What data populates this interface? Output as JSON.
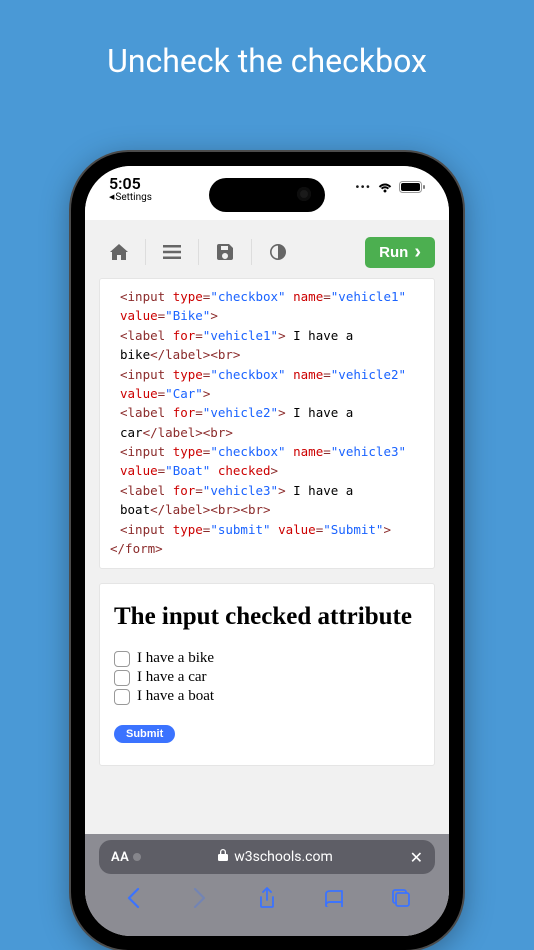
{
  "banner": "Uncheck the checkbox",
  "status": {
    "time": "5:05",
    "back_label": "Settings"
  },
  "toolbar": {
    "run_label": "Run"
  },
  "code": {
    "lines": [
      {
        "indent": 1,
        "parts": [
          {
            "c": "tag",
            "t": "<input"
          },
          {
            "c": "txt",
            "t": " "
          },
          {
            "c": "attr",
            "t": "type"
          },
          {
            "c": "tag",
            "t": "="
          },
          {
            "c": "val",
            "t": "\"checkbox\""
          },
          {
            "c": "txt",
            "t": " "
          },
          {
            "c": "attr",
            "t": "name"
          },
          {
            "c": "tag",
            "t": "="
          },
          {
            "c": "val",
            "t": "\"vehicle1\""
          },
          {
            "c": "txt",
            "t": " "
          },
          {
            "c": "attr",
            "t": "value"
          },
          {
            "c": "tag",
            "t": "="
          },
          {
            "c": "val",
            "t": "\"Bike\""
          },
          {
            "c": "tag",
            "t": ">"
          }
        ]
      },
      {
        "indent": 1,
        "parts": [
          {
            "c": "tag",
            "t": "<label"
          },
          {
            "c": "txt",
            "t": " "
          },
          {
            "c": "attr",
            "t": "for"
          },
          {
            "c": "tag",
            "t": "="
          },
          {
            "c": "val",
            "t": "\"vehicle1\""
          },
          {
            "c": "tag",
            "t": ">"
          },
          {
            "c": "txt",
            "t": " I have a bike"
          },
          {
            "c": "tag",
            "t": "</label><br>"
          }
        ]
      },
      {
        "indent": 1,
        "parts": [
          {
            "c": "tag",
            "t": "<input"
          },
          {
            "c": "txt",
            "t": " "
          },
          {
            "c": "attr",
            "t": "type"
          },
          {
            "c": "tag",
            "t": "="
          },
          {
            "c": "val",
            "t": "\"checkbox\""
          },
          {
            "c": "txt",
            "t": " "
          },
          {
            "c": "attr",
            "t": "name"
          },
          {
            "c": "tag",
            "t": "="
          },
          {
            "c": "val",
            "t": "\"vehicle2\""
          },
          {
            "c": "txt",
            "t": " "
          },
          {
            "c": "attr",
            "t": "value"
          },
          {
            "c": "tag",
            "t": "="
          },
          {
            "c": "val",
            "t": "\"Car\""
          },
          {
            "c": "tag",
            "t": ">"
          }
        ]
      },
      {
        "indent": 1,
        "parts": [
          {
            "c": "tag",
            "t": "<label"
          },
          {
            "c": "txt",
            "t": " "
          },
          {
            "c": "attr",
            "t": "for"
          },
          {
            "c": "tag",
            "t": "="
          },
          {
            "c": "val",
            "t": "\"vehicle2\""
          },
          {
            "c": "tag",
            "t": ">"
          },
          {
            "c": "txt",
            "t": " I have a car"
          },
          {
            "c": "tag",
            "t": "</label><br>"
          }
        ]
      },
      {
        "indent": 1,
        "parts": [
          {
            "c": "tag",
            "t": "<input"
          },
          {
            "c": "txt",
            "t": " "
          },
          {
            "c": "attr",
            "t": "type"
          },
          {
            "c": "tag",
            "t": "="
          },
          {
            "c": "val",
            "t": "\"checkbox\""
          },
          {
            "c": "txt",
            "t": " "
          },
          {
            "c": "attr",
            "t": "name"
          },
          {
            "c": "tag",
            "t": "="
          },
          {
            "c": "val",
            "t": "\"vehicle3\""
          },
          {
            "c": "txt",
            "t": " "
          },
          {
            "c": "attr",
            "t": "value"
          },
          {
            "c": "tag",
            "t": "="
          },
          {
            "c": "val",
            "t": "\"Boat\""
          },
          {
            "c": "txt",
            "t": " "
          },
          {
            "c": "attr",
            "t": "checked"
          },
          {
            "c": "tag",
            "t": ">"
          }
        ]
      },
      {
        "indent": 1,
        "parts": [
          {
            "c": "tag",
            "t": "<label"
          },
          {
            "c": "txt",
            "t": " "
          },
          {
            "c": "attr",
            "t": "for"
          },
          {
            "c": "tag",
            "t": "="
          },
          {
            "c": "val",
            "t": "\"vehicle3\""
          },
          {
            "c": "tag",
            "t": ">"
          },
          {
            "c": "txt",
            "t": " I have a boat"
          },
          {
            "c": "tag",
            "t": "</label><br><br>"
          }
        ]
      },
      {
        "indent": 1,
        "parts": [
          {
            "c": "tag",
            "t": "<input"
          },
          {
            "c": "txt",
            "t": " "
          },
          {
            "c": "attr",
            "t": "type"
          },
          {
            "c": "tag",
            "t": "="
          },
          {
            "c": "val",
            "t": "\"submit\""
          },
          {
            "c": "txt",
            "t": " "
          },
          {
            "c": "attr",
            "t": "value"
          },
          {
            "c": "tag",
            "t": "="
          },
          {
            "c": "val",
            "t": "\"Submit\""
          },
          {
            "c": "tag",
            "t": ">"
          }
        ]
      },
      {
        "indent": 0,
        "parts": [
          {
            "c": "tag",
            "t": "</form>"
          }
        ]
      }
    ]
  },
  "result": {
    "heading": "The input checked attribute",
    "items": [
      {
        "label": "I have a bike",
        "checked": false
      },
      {
        "label": "I have a car",
        "checked": false
      },
      {
        "label": "I have a boat",
        "checked": false
      }
    ],
    "submit_label": "Submit"
  },
  "browser": {
    "aa_label": "AA",
    "domain": "w3schools.com"
  }
}
